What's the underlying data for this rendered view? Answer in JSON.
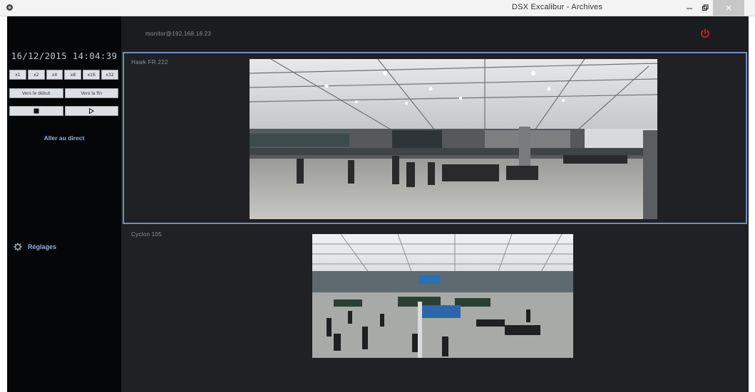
{
  "window": {
    "title": "DSX Excalibur - Archives"
  },
  "sidebar": {
    "datetime": "16/12/2015 14:04:39",
    "speed_buttons": [
      "x1",
      "x2",
      "x4",
      "x8",
      "x16",
      "x32"
    ],
    "nav_buttons": [
      "Vers le début",
      "Vers la fin"
    ],
    "live_link": "Aller au direct",
    "settings_label": "Réglages"
  },
  "topbar": {
    "user": "monitor@192.168.18.23"
  },
  "cameras": [
    {
      "label": "Hawk FR 222"
    },
    {
      "label": "Cyclon 105"
    }
  ],
  "colors": {
    "accent": "#8fb3e8",
    "power": "#e02020",
    "selected_border": "#6f8fb8"
  }
}
